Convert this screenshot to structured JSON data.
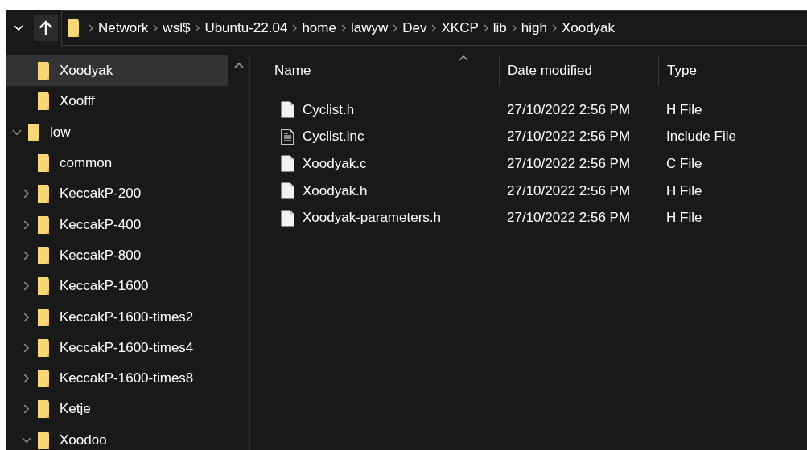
{
  "breadcrumb": [
    "Network",
    "wsl$",
    "Ubuntu-22.04",
    "home",
    "lawyw",
    "Dev",
    "XKCP",
    "lib",
    "high",
    "Xoodyak"
  ],
  "sidebar": {
    "tree": [
      {
        "children": [
          {
            "label": "Xoodyak",
            "selected": true
          },
          {
            "label": "Xoofff",
            "selected": false
          }
        ]
      },
      {
        "label": "low",
        "selected": false,
        "expanded": true,
        "children": [
          {
            "label": "common",
            "selected": false
          },
          {
            "label": "KeccakP-200",
            "selected": false,
            "expanded": false
          },
          {
            "label": "KeccakP-400",
            "selected": false,
            "expanded": false
          },
          {
            "label": "KeccakP-800",
            "selected": false,
            "expanded": false
          },
          {
            "label": "KeccakP-1600",
            "selected": false,
            "expanded": false
          },
          {
            "label": "KeccakP-1600-times2",
            "selected": false,
            "expanded": false
          },
          {
            "label": "KeccakP-1600-times4",
            "selected": false,
            "expanded": false
          },
          {
            "label": "KeccakP-1600-times8",
            "selected": false,
            "expanded": false
          },
          {
            "label": "Ketje",
            "selected": false,
            "expanded": false
          },
          {
            "label": "Xoodoo",
            "selected": false,
            "expanded": true
          }
        ]
      }
    ]
  },
  "table": {
    "columns": [
      {
        "label": "Name",
        "sorted": true
      },
      {
        "label": "Date modified",
        "sorted": false
      },
      {
        "label": "Type",
        "sorted": false
      }
    ],
    "rows": [
      {
        "kind": "blank",
        "name": "Cyclist.h",
        "date": "27/10/2022 2:56 PM",
        "type": "H File"
      },
      {
        "kind": "text",
        "name": "Cyclist.inc",
        "date": "27/10/2022 2:56 PM",
        "type": "Include File"
      },
      {
        "kind": "blank",
        "name": "Xoodyak.c",
        "date": "27/10/2022 2:56 PM",
        "type": "C File"
      },
      {
        "kind": "blank",
        "name": "Xoodyak.h",
        "date": "27/10/2022 2:56 PM",
        "type": "H File"
      },
      {
        "kind": "blank",
        "name": "Xoodyak-parameters.h",
        "date": "27/10/2022 2:56 PM",
        "type": "H File"
      }
    ]
  }
}
